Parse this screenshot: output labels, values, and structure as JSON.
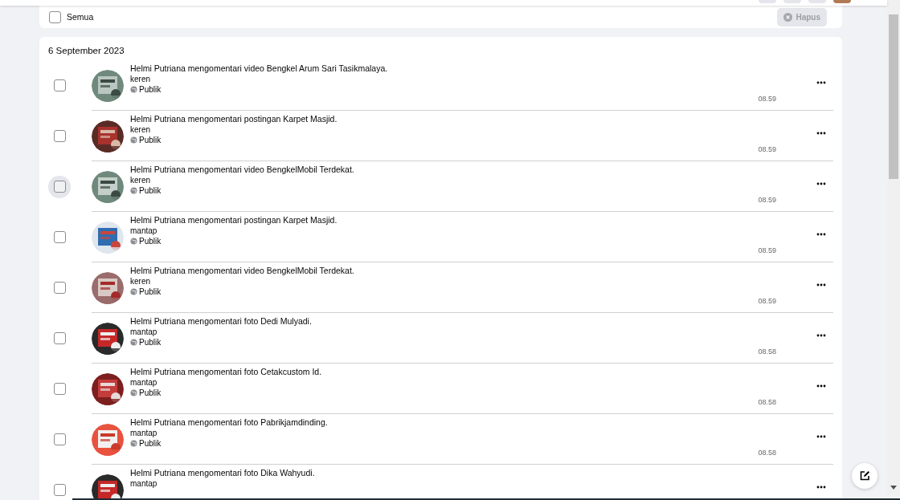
{
  "select_all": {
    "label": "Semua",
    "checked": false
  },
  "delete_button": {
    "label": "Hapus",
    "disabled": true
  },
  "date_group": {
    "date": "6 September 2023",
    "rows": [
      {
        "title": "Helmi Putriana mengomentari video Bengkel Arum Sari Tasikmalaya.",
        "comment": "keren",
        "privacy": "Publik",
        "time": "08.59",
        "checked": false,
        "hovered": false
      },
      {
        "title": "Helmi Putriana mengomentari postingan Karpet Masjid.",
        "comment": "keren",
        "privacy": "Publik",
        "time": "08.59",
        "checked": false,
        "hovered": false
      },
      {
        "title": "Helmi Putriana mengomentari video BengkelMobil Terdekat.",
        "comment": "keren",
        "privacy": "Publik",
        "time": "08.59",
        "checked": false,
        "hovered": true
      },
      {
        "title": "Helmi Putriana mengomentari postingan Karpet Masjid.",
        "comment": "mantap",
        "privacy": "Publik",
        "time": "08.59",
        "checked": false,
        "hovered": false
      },
      {
        "title": "Helmi Putriana mengomentari video BengkelMobil Terdekat.",
        "comment": "keren",
        "privacy": "Publik",
        "time": "08.59",
        "checked": false,
        "hovered": false
      },
      {
        "title": "Helmi Putriana mengomentari foto Dedi Mulyadi.",
        "comment": "mantap",
        "privacy": "Publik",
        "time": "08.58",
        "checked": false,
        "hovered": false
      },
      {
        "title": "Helmi Putriana mengomentari foto Cetakcustom Id.",
        "comment": "mantap",
        "privacy": "Publik",
        "time": "08.58",
        "checked": false,
        "hovered": false
      },
      {
        "title": "Helmi Putriana mengomentari foto Pabrikjamdinding.",
        "comment": "mantap",
        "privacy": "Publik",
        "time": "08.58",
        "checked": false,
        "hovered": false
      },
      {
        "title": "Helmi Putriana mengomentari foto Dika Wahyudi.",
        "comment": "mantap",
        "checked": false,
        "hovered": false
      }
    ]
  }
}
